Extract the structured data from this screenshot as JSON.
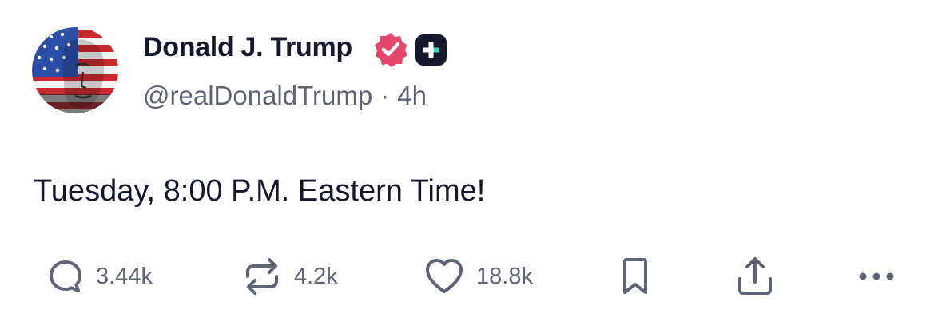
{
  "author": {
    "display_name": "Donald J. Trump",
    "handle": "@realDonaldTrump",
    "separator": "·",
    "time_ago": "4h",
    "verified_color": "#e4476b",
    "plus_badge_color": "#15182b"
  },
  "post": {
    "text": "Tuesday, 8:00 P.M. Eastern Time!"
  },
  "actions": {
    "replies": "3.44k",
    "retruths": "4.2k",
    "likes": "18.8k",
    "icons": [
      "reply-icon",
      "retruth-icon",
      "heart-icon",
      "bookmark-icon",
      "share-icon",
      "more-icon"
    ]
  },
  "colors": {
    "text_primary": "#15182b",
    "text_secondary": "#5f6475",
    "accent_teal": "#3fd7c7"
  }
}
